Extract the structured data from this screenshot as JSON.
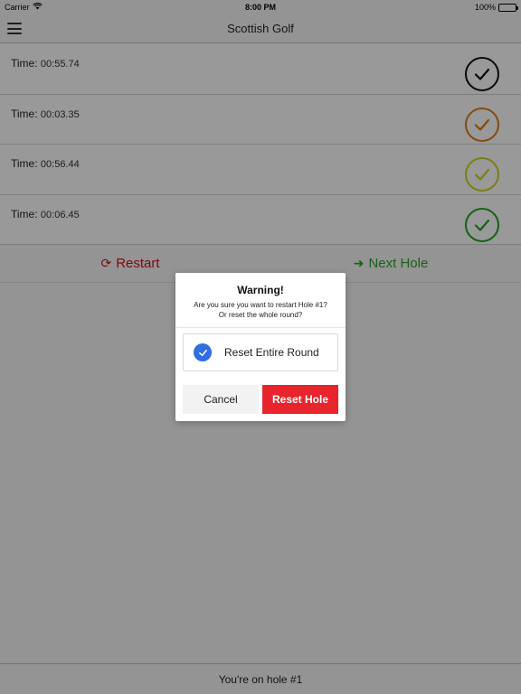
{
  "status_bar": {
    "carrier": "Carrier",
    "time": "8:00 PM",
    "battery": "100%",
    "battery_level": 1.0
  },
  "nav": {
    "title": "Scottish Golf",
    "menu_icon": "hamburger-menu-icon"
  },
  "holes": [
    {
      "label": "Time:",
      "time": "00:55.74",
      "check_color": "#111111"
    },
    {
      "label": "Time:",
      "time": "00:03.35",
      "check_color": "#e07a1a"
    },
    {
      "label": "Time:",
      "time": "00:56.44",
      "check_color": "#cfd21c"
    },
    {
      "label": "Time:",
      "time": "00:06.45",
      "check_color": "#22a322"
    }
  ],
  "actions": {
    "restart_label": "Restart",
    "restart_icon": "refresh-icon",
    "restart_color": "#d4101a",
    "next_label": "Next Hole",
    "next_icon": "arrow-right-icon",
    "next_color": "#2ea02e"
  },
  "footer": {
    "text": "You're on hole #1"
  },
  "dialog": {
    "title": "Warning!",
    "message_line1": "Are you sure you want to restart Hole #1?",
    "message_line2": "Or reset the whole round?",
    "option_label": "Reset Entire Round",
    "option_checked": true,
    "option_check_color": "#2f6fe0",
    "cancel_label": "Cancel",
    "reset_label": "Reset Hole",
    "reset_color": "#e8242d"
  }
}
